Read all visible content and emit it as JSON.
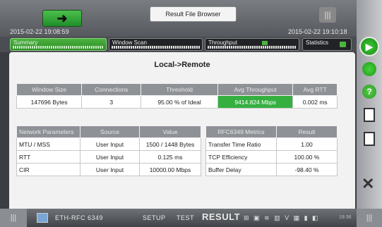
{
  "header": {
    "title": "Result File Browser",
    "timestamp_left": "2015-02-22 19:08:59",
    "timestamp_right": "2015-02-22 19:10:18",
    "arrow_label": "➜",
    "grip_label": "|||"
  },
  "tabs": [
    {
      "label": "Summary"
    },
    {
      "label": "Window Scan"
    },
    {
      "label": "Throughput"
    },
    {
      "label": "Statistics"
    }
  ],
  "main": {
    "direction": "Local->Remote",
    "summary_table": {
      "headers": [
        "Window Size",
        "Connections",
        "Threshold",
        "Avg Throughput",
        "Avg RTT"
      ],
      "row": [
        "147696 Bytes",
        "3",
        "95.00 % of Ideal",
        "9414.824 Mbps",
        "0.002 ms"
      ]
    },
    "network_table": {
      "headers": [
        "Network Parameters",
        "Source",
        "Value"
      ],
      "rows": [
        [
          "MTU / MSS",
          "User Input",
          "1500 / 1448 Bytes"
        ],
        [
          "RTT",
          "User Input",
          "0.125 ms"
        ],
        [
          "CIR",
          "User Input",
          "10000.00 Mbps"
        ]
      ]
    },
    "rfc_table": {
      "headers": [
        "RFC6349 Metrics",
        "Result"
      ],
      "rows": [
        [
          "Transfer Time Ratio",
          "1.00"
        ],
        [
          "TCP Efficiency",
          "100.00 %"
        ],
        [
          "Buffer Delay",
          "-98.40 %"
        ]
      ]
    }
  },
  "bottom": {
    "product": "ETH-RFC 6349",
    "setup": "SETUP",
    "test": "TEST",
    "result": "RESULT",
    "status_icons": "⊞ ▣ ≋ ▥ V ▦ ▮ ◧",
    "time": "19:36",
    "grip": "|||"
  },
  "side": {
    "play": "▶",
    "help": "?",
    "close": "✕"
  },
  "colors": {
    "accent_green": "#35b040",
    "header_gray": "#8e9196"
  }
}
